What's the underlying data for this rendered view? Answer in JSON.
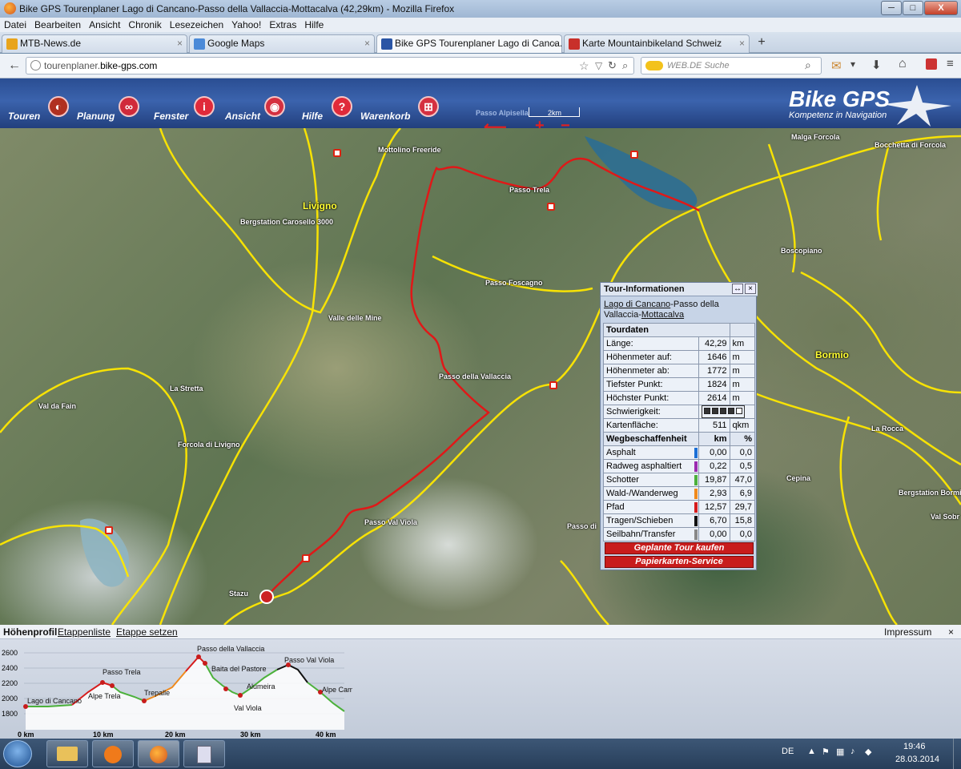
{
  "window": {
    "title": "Bike GPS Tourenplaner Lago di Cancano-Passo della Vallaccia-Mottacalva (42,29km) - Mozilla Firefox",
    "controls": {
      "minimize": "─",
      "maximize": "□",
      "close": "X"
    }
  },
  "menubar": [
    "Datei",
    "Bearbeiten",
    "Ansicht",
    "Chronik",
    "Lesezeichen",
    "Yahoo!",
    "Extras",
    "Hilfe"
  ],
  "tabs": [
    {
      "label": "MTB-News.de",
      "color": "#e8a41c"
    },
    {
      "label": "Google Maps",
      "color": "#4b8ad8"
    },
    {
      "label": "Bike GPS Tourenplaner Lago di Canca...",
      "color": "#2a55a5"
    },
    {
      "label": "Karte Mountainbikeland Schweiz",
      "color": "#c8302a"
    }
  ],
  "newtab": "+",
  "nav": {
    "back": "←",
    "url_host": "tourenplaner.",
    "url_domain": "bike-gps.com",
    "search_placeholder": "WEB.DE Suche"
  },
  "app": {
    "menu": [
      {
        "label": "Touren",
        "icon": "◐"
      },
      {
        "label": "Planung",
        "icon": "∞"
      },
      {
        "label": "Fenster",
        "icon": "i"
      },
      {
        "label": "Ansicht",
        "icon": "◉"
      },
      {
        "label": "Hilfe",
        "icon": "?"
      },
      {
        "label": "Warenkorb",
        "icon": "⊞"
      }
    ],
    "brand": "Bike GPS",
    "brand_sub": "Kompetenz in Navigation",
    "scale": "2km",
    "scale_place": "Passo Alpisella",
    "zoom_minus": "−",
    "zoom_plus": "+"
  },
  "map_labels": [
    "Mottolino Freeride",
    "Livigno",
    "Bergstation Carosello 3000",
    "Passo Trela",
    "Malga Forcola",
    "Bocchetta di Forcola",
    "Boscopiano",
    "Passo Foscagno",
    "Valle delle Mine",
    "Passo della Vallaccia",
    "La Stretta",
    "Val da Fain",
    "Forcola di Livigno",
    "Passo Val Viola",
    "Stazu",
    "Bormio",
    "La Rocca",
    "Cepina",
    "Bergstation Bormi",
    "Val Sobr",
    "Passo di"
  ],
  "tour_panel": {
    "title": "Tour-Informationen",
    "resize": "↔",
    "close": "×",
    "name_start": "Lago di Cancano",
    "name_mid": "-Passo della Vallaccia-",
    "name_end": "Mottacalva",
    "section1": "Tourdaten",
    "rows": [
      {
        "label": "Länge:",
        "value": "42,29",
        "unit": "km"
      },
      {
        "label": "Höhenmeter auf:",
        "value": "1646",
        "unit": "m"
      },
      {
        "label": "Höhenmeter ab:",
        "value": "1772",
        "unit": "m"
      },
      {
        "label": "Tiefster Punkt:",
        "value": "1824",
        "unit": "m"
      },
      {
        "label": "Höchster Punkt:",
        "value": "2614",
        "unit": "m"
      }
    ],
    "difficulty_label": "Schwierigkeit:",
    "difficulty_level": 4,
    "area_label": "Kartenfläche:",
    "area_value": "511",
    "area_unit": "qkm",
    "section2": "Wegbeschaffenheit",
    "col_km": "km",
    "col_pct": "%",
    "surfaces": [
      {
        "label": "Asphalt",
        "km": "0,00",
        "pct": "0,0",
        "color": "#1b6fd6"
      },
      {
        "label": "Radweg asphaltiert",
        "km": "0,22",
        "pct": "0,5",
        "color": "#9b2ab0"
      },
      {
        "label": "Schotter",
        "km": "19,87",
        "pct": "47,0",
        "color": "#4cb13b"
      },
      {
        "label": "Wald-/Wanderweg",
        "km": "2,93",
        "pct": "6,9",
        "color": "#f08a1c"
      },
      {
        "label": "Pfad",
        "km": "12,57",
        "pct": "29,7",
        "color": "#d61c1c"
      },
      {
        "label": "Tragen/Schieben",
        "km": "6,70",
        "pct": "15,8",
        "color": "#111111"
      },
      {
        "label": "Seilbahn/Transfer",
        "km": "0,00",
        "pct": "0,0",
        "color": "#888888"
      }
    ],
    "btn_buy": "Geplante Tour kaufen",
    "btn_maps": "Papierkarten-Service"
  },
  "elevation": {
    "tabs": [
      "Höhenprofil",
      "Etappenliste",
      "Etappe setzen"
    ],
    "impressum": "Impressum",
    "close": "×",
    "yticks": [
      "2600",
      "2400",
      "2200",
      "2000",
      "1800"
    ],
    "xticks": [
      "0 km",
      "10 km",
      "20 km",
      "30 km",
      "40 km"
    ],
    "waypoints": [
      "Lago di Cancano",
      "Passo Trela",
      "Alpe Trela",
      "Trepalle",
      "Passo della Vallaccia",
      "Baita del Pastore",
      "Val Viola",
      "Alumeira",
      "Passo Val Viola",
      "Alpe Campo"
    ]
  },
  "taskbar": {
    "lang": "DE",
    "time": "19:46",
    "date": "28.03.2014"
  }
}
